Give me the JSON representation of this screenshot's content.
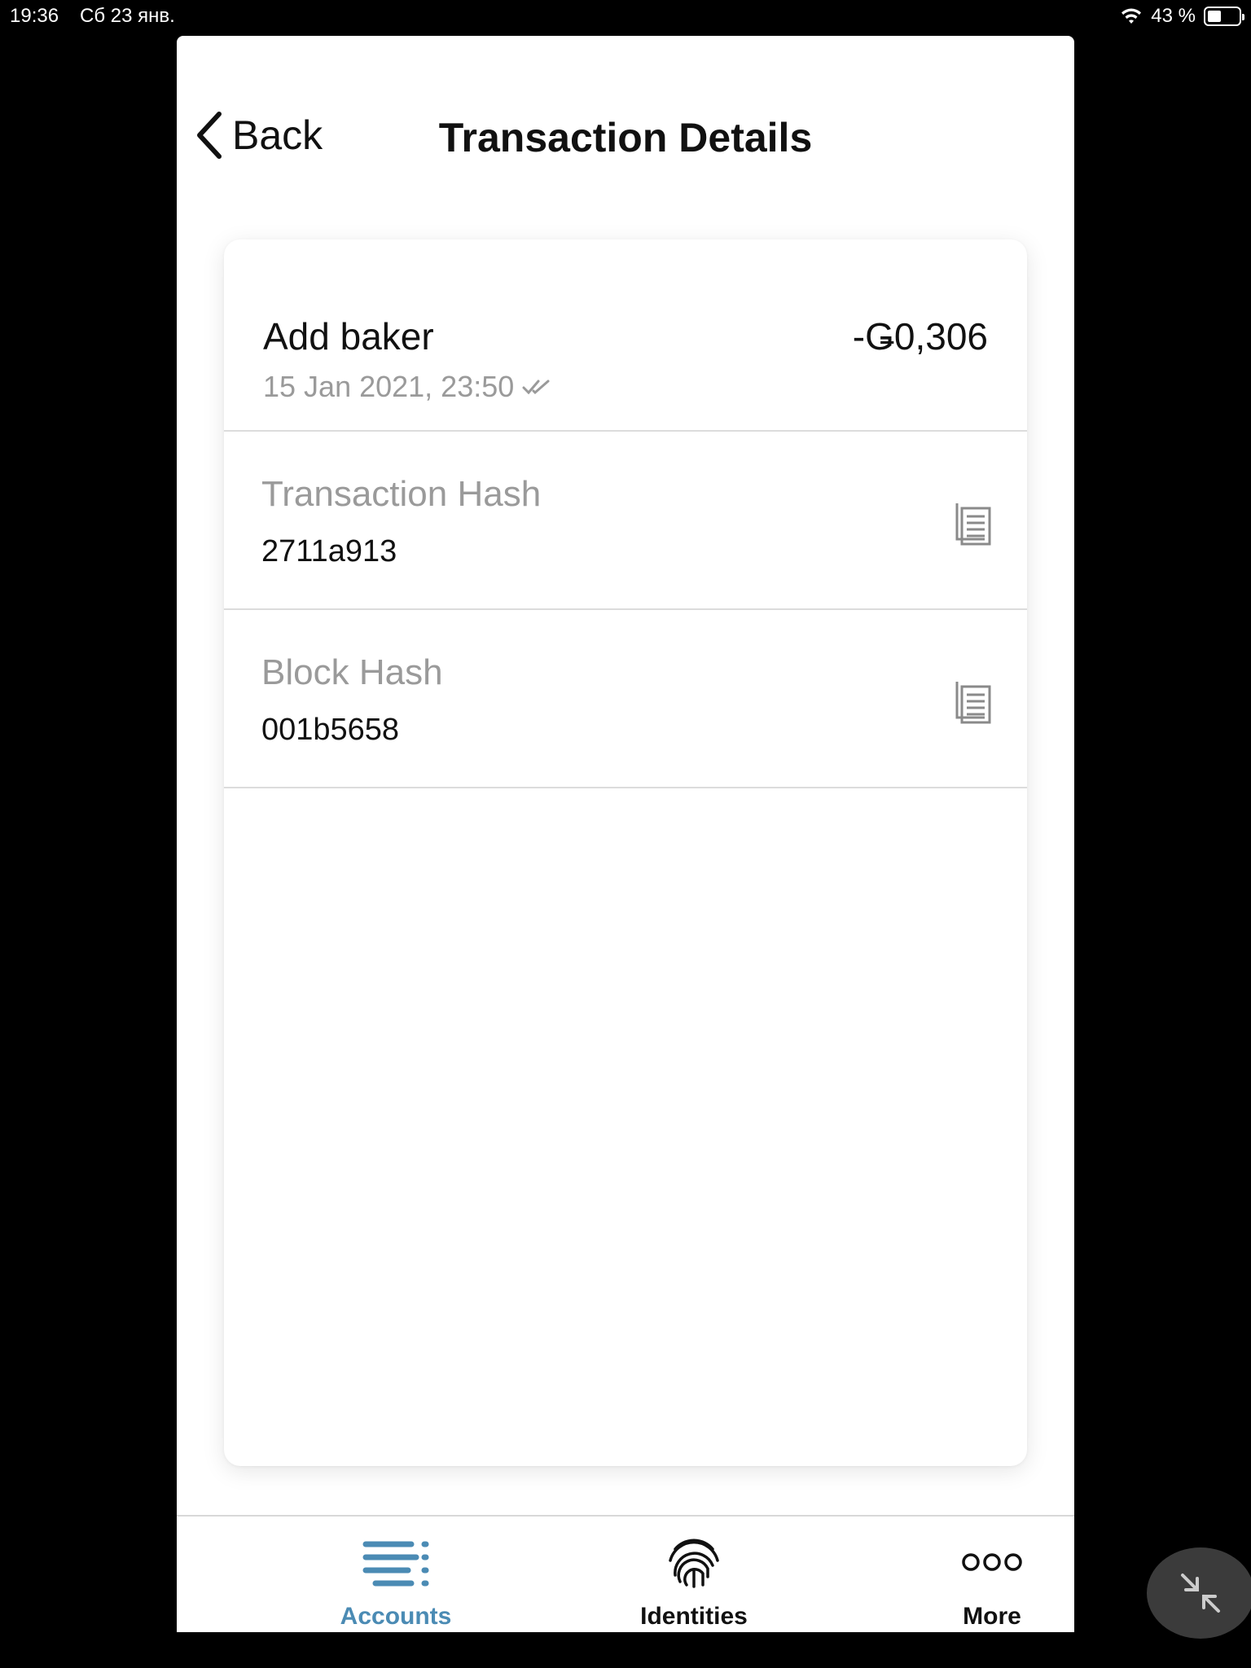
{
  "status_bar": {
    "time": "19:36",
    "date": "Сб 23 янв.",
    "battery": "43 %"
  },
  "header": {
    "back_label": "Back",
    "title": "Transaction Details"
  },
  "transaction": {
    "type": "Add baker",
    "amount": "-Ǥ0,306",
    "date": "15 Jan 2021, 23:50",
    "status_icon": "double-check-icon"
  },
  "details": [
    {
      "label": "Transaction Hash",
      "value": "2711a913",
      "icon": "copy-icon"
    },
    {
      "label": "Block Hash",
      "value": "001b5658",
      "icon": "copy-icon"
    }
  ],
  "tabbar": {
    "tabs": [
      {
        "label": "Accounts",
        "icon": "accounts-icon",
        "active": true
      },
      {
        "label": "Identities",
        "icon": "fingerprint-icon",
        "active": false
      },
      {
        "label": "More",
        "icon": "more-icon",
        "active": false
      }
    ]
  },
  "colors": {
    "accent": "#4b8bb4",
    "muted_text": "#9a9a9a",
    "background": "#000000"
  }
}
